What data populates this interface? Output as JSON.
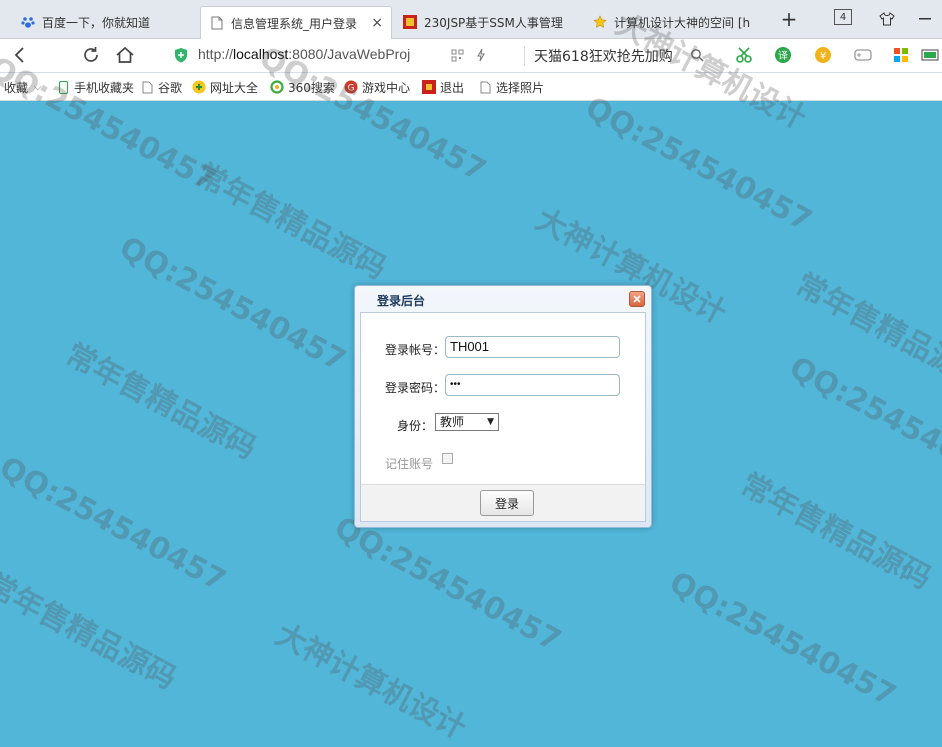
{
  "tabs": [
    {
      "label": "百度一下，你就知道",
      "icon": "paw-icon"
    },
    {
      "label": "信息管理系统_用户登录",
      "icon": "page-icon",
      "close": "×"
    },
    {
      "label": "230JSP基于SSM人事管理",
      "icon": "favicon-red-icon"
    },
    {
      "label": "计算机设计大神的空间 [h",
      "icon": "star-icon"
    }
  ],
  "new_tab": "+",
  "tab_count": "4",
  "address": {
    "url_prefix": "http://",
    "url_host": "localhost",
    "url_rest": ":8080/JavaWebProj",
    "promo": "天猫618狂欢抢先加购"
  },
  "bookmarks": [
    {
      "label": "收藏",
      "icon": "star-icon"
    },
    {
      "label": "手机收藏夹",
      "icon": "phone-icon"
    },
    {
      "label": "谷歌",
      "icon": "page-icon"
    },
    {
      "label": "网址大全",
      "icon": "globe-icon"
    },
    {
      "label": "360搜索",
      "icon": "search-360-icon"
    },
    {
      "label": "游戏中心",
      "icon": "game-icon"
    },
    {
      "label": "退出",
      "icon": "exit-icon"
    },
    {
      "label": "选择照片",
      "icon": "page-icon"
    }
  ],
  "dialog": {
    "title": "登录后台",
    "account_label": "登录帐号：",
    "account_value": "TH001",
    "password_label": "登录密码：",
    "password_value": "•••",
    "role_label": "身份：",
    "role_value": "教师",
    "remember_label": "记住账号",
    "login_button": "登录"
  },
  "colors": {
    "background": "#52b6d9",
    "dialog_title": "#1e3a5c",
    "close_button": "#d9643f"
  },
  "watermark": [
    "QQ:254540457",
    "常年售精品源码",
    "大神计算机设计"
  ]
}
